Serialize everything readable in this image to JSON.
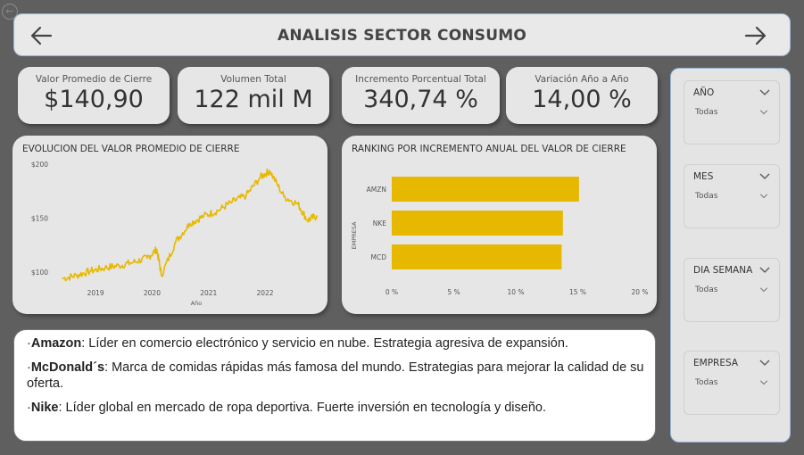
{
  "header": {
    "title": "ANALISIS SECTOR CONSUMO",
    "back_icon": "arrow-left-icon",
    "forward_icon": "arrow-right-icon"
  },
  "kpis": [
    {
      "label": "Valor Promedio de Cierre",
      "value": "$140,90"
    },
    {
      "label": "Volumen Total",
      "value": "122 mil M"
    },
    {
      "label": "Incremento Porcentual Total",
      "value": "340,74 %"
    },
    {
      "label": "Variación Año a Año",
      "value": "14,00 %"
    }
  ],
  "line_chart": {
    "title": "EVOLUCION DEL VALOR PROMEDIO DE CIERRE"
  },
  "bar_chart": {
    "title": "RANKING POR INCREMENTO ANUAL DEL VALOR DE CIERRE"
  },
  "chart_data": [
    {
      "type": "line",
      "title": "EVOLUCION DEL VALOR PROMEDIO DE CIERRE",
      "xlabel": "Año",
      "ylabel": "",
      "x_ticks": [
        "2019",
        "2020",
        "2021",
        "2022"
      ],
      "y_ticks": [
        "$100",
        "$150",
        "$200"
      ],
      "ylim": [
        90,
        205
      ],
      "x": [
        "2018-06",
        "2018-09",
        "2018-12",
        "2019-03",
        "2019-06",
        "2019-09",
        "2019-12",
        "2020-02",
        "2020-03",
        "2020-06",
        "2020-09",
        "2020-12",
        "2021-03",
        "2021-06",
        "2021-09",
        "2021-12",
        "2022-02",
        "2022-05",
        "2022-08",
        "2022-10",
        "2022-12"
      ],
      "y": [
        94,
        97,
        101,
        104,
        106,
        109,
        113,
        121,
        97,
        128,
        145,
        152,
        157,
        165,
        171,
        188,
        194,
        170,
        163,
        148,
        152
      ],
      "color": "#e6b800",
      "grid": false
    },
    {
      "type": "bar",
      "orientation": "horizontal",
      "title": "RANKING POR INCREMENTO ANUAL DEL VALOR DE CIERRE",
      "ylabel": "EMPRESA",
      "categories": [
        "AMZN",
        "NKE",
        "MCD"
      ],
      "values": [
        15.1,
        13.8,
        13.7
      ],
      "x_ticks": [
        "0 %",
        "5 %",
        "10 %",
        "15 %",
        "20 %"
      ],
      "xlim": [
        0,
        20
      ],
      "color": "#e6b800",
      "grid": false
    }
  ],
  "notes": [
    {
      "name": "Amazon",
      "text": ": Líder en comercio electrónico y servicio en nube. Estrategia agresiva de expansión."
    },
    {
      "name": "McDonald´s",
      "text": ": Marca de comidas rápidas más famosa del mundo. Estrategias para mejorar la calidad de su oferta."
    },
    {
      "name": "Nike",
      "text": ": Líder global en mercado de ropa deportiva. Fuerte inversión en tecnología y diseño."
    }
  ],
  "slicers": [
    {
      "title": "AÑO",
      "value": "Todas"
    },
    {
      "title": "MES",
      "value": "Todas"
    },
    {
      "title": "DIA SEMANA",
      "value": "Todas"
    },
    {
      "title": "EMPRESA",
      "value": "Todas"
    }
  ],
  "colors": {
    "background": "#5f5f5f",
    "card": "#e6e6e6",
    "accent_border": "#9bb3d6",
    "series": "#e6b800"
  }
}
